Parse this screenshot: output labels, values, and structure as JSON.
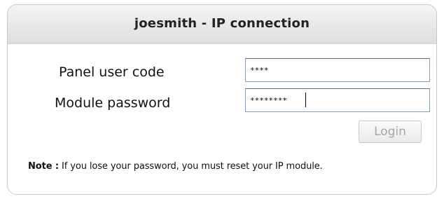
{
  "panel": {
    "title": "joesmith - IP connection"
  },
  "form": {
    "user_code_label": "Panel user code",
    "user_code_value": "****",
    "module_password_label": "Module password",
    "module_password_value": "********",
    "login_button_label": "Login",
    "login_button_enabled": false
  },
  "note": {
    "label": "Note :",
    "text": " If you lose your password, you must reset your IP module."
  }
}
